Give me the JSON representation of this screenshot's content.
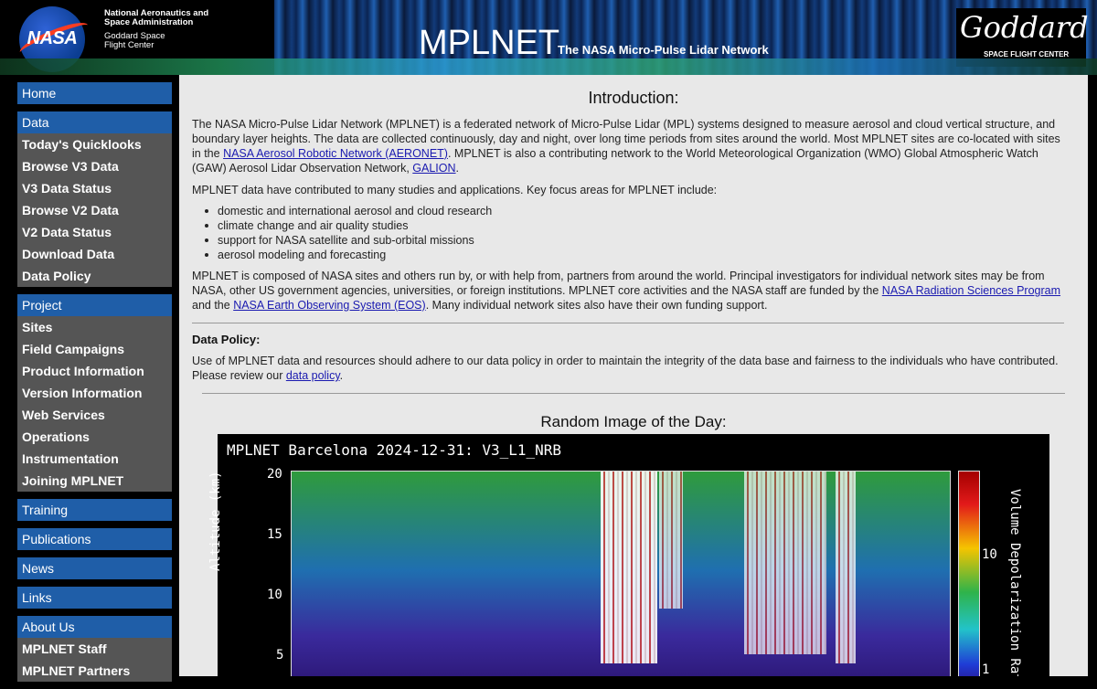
{
  "header": {
    "agency_line1": "National Aeronautics and",
    "agency_line2": "Space Administration",
    "center_line1": "Goddard Space",
    "center_line2": "Flight Center",
    "nasa_logo": "NASA",
    "title": "MPLNET",
    "subtitle": "The NASA Micro-Pulse Lidar Network",
    "goddard_script": "Goddard",
    "goddard_sub": "SPACE FLIGHT CENTER"
  },
  "sidebar": {
    "groups": [
      {
        "head": "Home",
        "items": []
      },
      {
        "head": "Data",
        "items": [
          "Today's Quicklooks",
          "Browse V3 Data",
          "V3 Data Status",
          "Browse V2 Data",
          "V2 Data Status",
          "Download Data",
          "Data Policy"
        ]
      },
      {
        "head": "Project",
        "items": [
          "Sites",
          "Field Campaigns",
          "Product Information",
          "Version Information",
          "Web Services",
          "Operations",
          "Instrumentation",
          "Joining MPLNET"
        ]
      },
      {
        "head": "Training",
        "items": []
      },
      {
        "head": "Publications",
        "items": []
      },
      {
        "head": "News",
        "items": []
      },
      {
        "head": "Links",
        "items": []
      },
      {
        "head": "About Us",
        "items": [
          "MPLNET Staff",
          "MPLNET Partners"
        ]
      }
    ]
  },
  "main": {
    "intro_title": "Introduction:",
    "p1_a": "The NASA Micro-Pulse Lidar Network (MPLNET) is a federated network of Micro-Pulse Lidar (MPL) systems designed to measure aerosol and cloud vertical structure, and boundary layer heights. The data are collected continuously, day and night, over long time periods from sites around the world. Most MPLNET sites are co-located with sites in the ",
    "p1_link1": "NASA Aerosol Robotic Network (AERONET)",
    "p1_b": ". MPLNET is also a contributing network to the World Meteorological Organization (WMO) Global Atmospheric Watch (GAW) Aerosol Lidar Observation Network, ",
    "p1_link2": "GALION",
    "p1_c": ".",
    "p2": "MPLNET data have contributed to many studies and applications. Key focus areas for MPLNET include:",
    "bullets": [
      "domestic and international aerosol and cloud research",
      "climate change and air quality studies",
      "support for NASA satellite and sub-orbital missions",
      "aerosol modeling and forecasting"
    ],
    "p3_a": "MPLNET is composed of NASA sites and others run by, or with help from, partners from around the world. Principal investigators for individual network sites may be from NASA, other US government agencies, universities, or foreign institutions. MPLNET core activities and the NASA staff are funded by the ",
    "p3_link1": "NASA Radiation Sciences Program",
    "p3_b": " and the ",
    "p3_link2": "NASA Earth Observing System (EOS)",
    "p3_c": ". Many individual network sites also have their own funding support.",
    "dp_title": "Data Policy:",
    "dp_a": "Use of MPLNET data and resources should adhere to our data policy in order to maintain the integrity of the data base and fairness to the individuals who have contributed. Please review our ",
    "dp_link": "data policy",
    "dp_b": ".",
    "riod_title": "Random Image of the Day:"
  },
  "plot": {
    "title": "MPLNET Barcelona 2024-12-31: V3_L1_NRB",
    "y_ticks": [
      "20",
      "15",
      "10",
      "5"
    ],
    "y_label": "Altitude (km)",
    "cb_ticks": [
      "10",
      "1"
    ],
    "cb_label": "Volume Depolarization Ratio"
  },
  "colors": {
    "nav_head": "#1f5ea8",
    "nav_body": "#555555",
    "content_bg": "#e8e8e8",
    "link": "#1a1ab0"
  }
}
